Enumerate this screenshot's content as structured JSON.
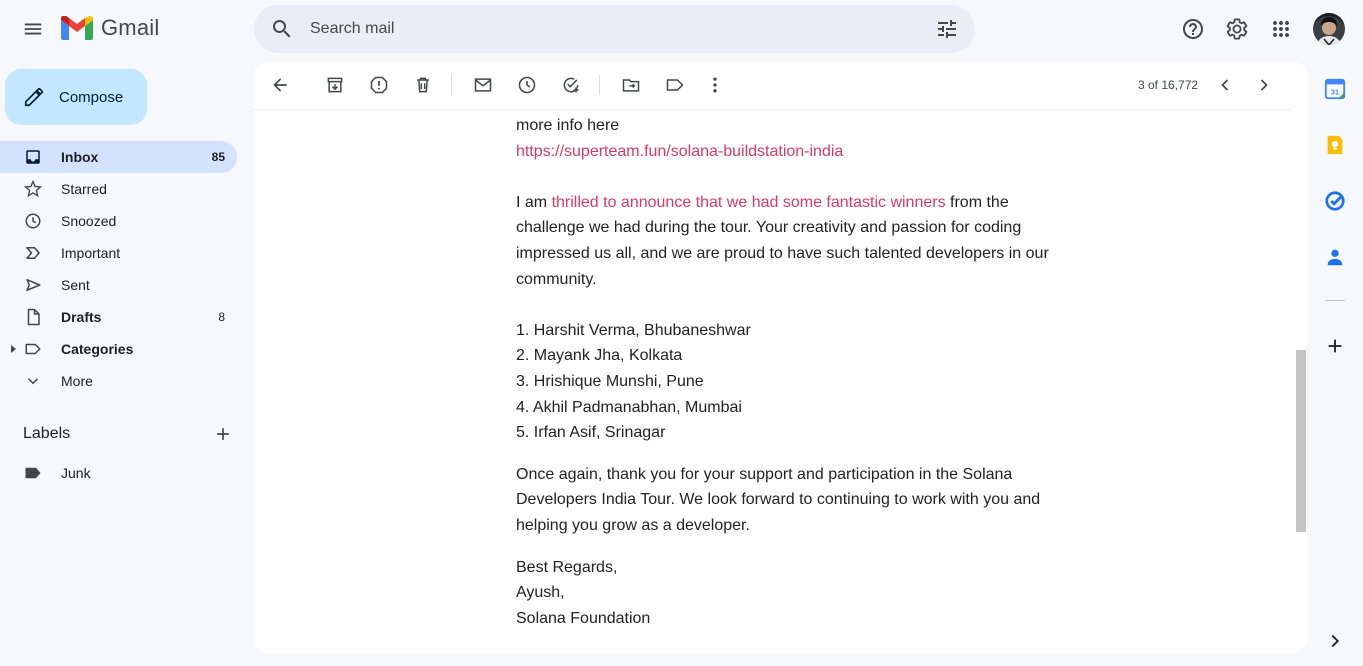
{
  "app": {
    "name": "Gmail"
  },
  "search": {
    "placeholder": "Search mail"
  },
  "compose": {
    "label": "Compose"
  },
  "nav": [
    {
      "label": "Inbox",
      "count": "85",
      "icon": "inbox-icon",
      "active": true,
      "bold": true
    },
    {
      "label": "Starred",
      "count": "",
      "icon": "star-icon"
    },
    {
      "label": "Snoozed",
      "count": "",
      "icon": "clock-icon"
    },
    {
      "label": "Important",
      "count": "",
      "icon": "important-icon"
    },
    {
      "label": "Sent",
      "count": "",
      "icon": "send-icon"
    },
    {
      "label": "Drafts",
      "count": "8",
      "icon": "draft-icon",
      "bold": true
    },
    {
      "label": "Categories",
      "count": "",
      "icon": "label-outline-icon",
      "bold": true
    },
    {
      "label": "More",
      "count": "",
      "icon": "chevron-down-icon"
    }
  ],
  "labels": {
    "title": "Labels",
    "items": [
      {
        "label": "Junk",
        "icon": "label-icon"
      }
    ]
  },
  "toolbar": {
    "pager": "3 of 16,772"
  },
  "email": {
    "intro": "more info here",
    "link": "https://superteam.fun/solana-buildstation-india",
    "p1_start": "I am ",
    "p1_link": "thrilled to announce that we had some fantastic winners",
    "p1_rest": " from the challenge we had during the tour. Your creativity and passion for coding impressed us all, and we are proud to have such talented developers in our community.",
    "winners": [
      "1. Harshit Verma, Bhubaneshwar",
      "2. Mayank Jha, Kolkata",
      "3. Hrishique Munshi, Pune",
      "4. Akhil Padmanabhan, Mumbai",
      "5. Irfan Asif, Srinagar"
    ],
    "p2": "Once again, thank you for your support and participation in the Solana Developers India Tour. We look forward to continuing to work with you and helping you grow as a developer.",
    "sign": [
      "Best Regards,",
      "Ayush,",
      "Solana Foundation"
    ]
  },
  "colors": {
    "accent": "#0b57d0",
    "link": "#d93a63",
    "active_nav": "#d3e3fd",
    "compose": "#c2e7ff"
  }
}
